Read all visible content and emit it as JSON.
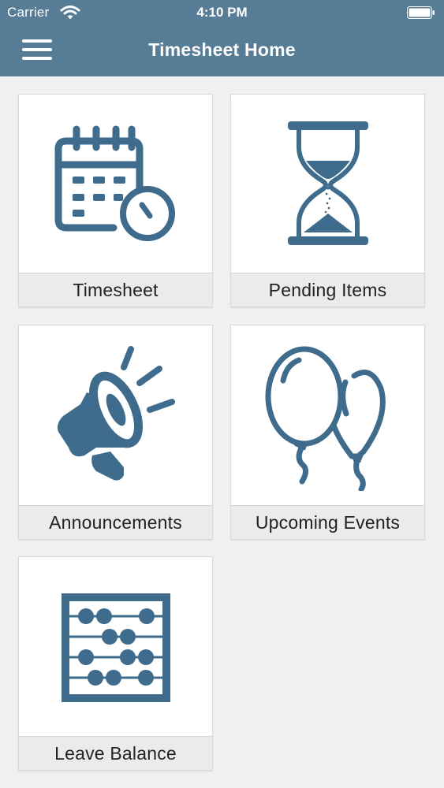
{
  "status_bar": {
    "carrier": "Carrier",
    "time": "4:10 PM"
  },
  "header": {
    "title": "Timesheet Home",
    "menu_icon": "hamburger-menu-icon"
  },
  "colors": {
    "header_bg": "#577d96",
    "icon": "#3f6b8c",
    "label_bg": "#ebebed",
    "page_bg": "#f0f0f0"
  },
  "tiles": [
    {
      "label": "Timesheet",
      "icon": "calendar-clock-icon"
    },
    {
      "label": "Pending Items",
      "icon": "hourglass-icon"
    },
    {
      "label": "Announcements",
      "icon": "megaphone-icon"
    },
    {
      "label": "Upcoming Events",
      "icon": "balloons-icon"
    },
    {
      "label": "Leave Balance",
      "icon": "abacus-icon"
    }
  ]
}
